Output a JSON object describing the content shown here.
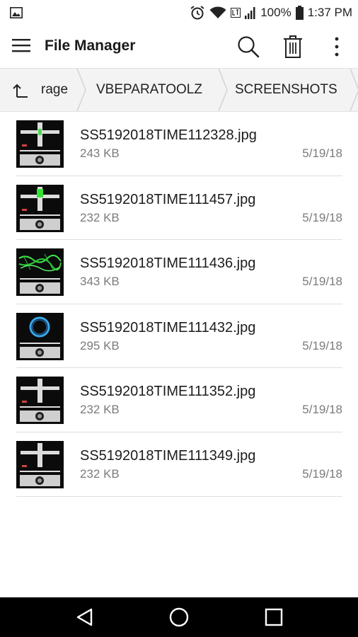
{
  "status_bar": {
    "battery": "100%",
    "time": "1:37 PM"
  },
  "app_bar": {
    "title": "File Manager"
  },
  "breadcrumb": {
    "items": [
      "rage",
      "VBEPARATOOLZ",
      "SCREENSHOTS"
    ]
  },
  "files": [
    {
      "name": "SS5192018TIME112328.jpg",
      "size": "243 KB",
      "date": "5/19/18"
    },
    {
      "name": "SS5192018TIME111457.jpg",
      "size": "232 KB",
      "date": "5/19/18"
    },
    {
      "name": "SS5192018TIME111436.jpg",
      "size": "343 KB",
      "date": "5/19/18"
    },
    {
      "name": "SS5192018TIME111432.jpg",
      "size": "295 KB",
      "date": "5/19/18"
    },
    {
      "name": "SS5192018TIME111352.jpg",
      "size": "232 KB",
      "date": "5/19/18"
    },
    {
      "name": "SS5192018TIME111349.jpg",
      "size": "232 KB",
      "date": "5/19/18"
    }
  ],
  "icons": {
    "status": [
      "gallery-notification-icon",
      "alarm-icon",
      "wifi-icon",
      "lte-icon",
      "signal-icon",
      "battery-icon"
    ],
    "app_bar": [
      "menu-icon",
      "search-icon",
      "delete-icon",
      "more-vert-icon"
    ],
    "breadcrumb": "up-arrow-icon",
    "nav": [
      "back-icon",
      "home-icon",
      "recents-icon"
    ]
  },
  "colors": {
    "nav_bar": "#000000",
    "breadcrumb_bg": "#f3f3f3",
    "accent_green": "#33e333",
    "accent_blue": "#3aa6e8"
  }
}
